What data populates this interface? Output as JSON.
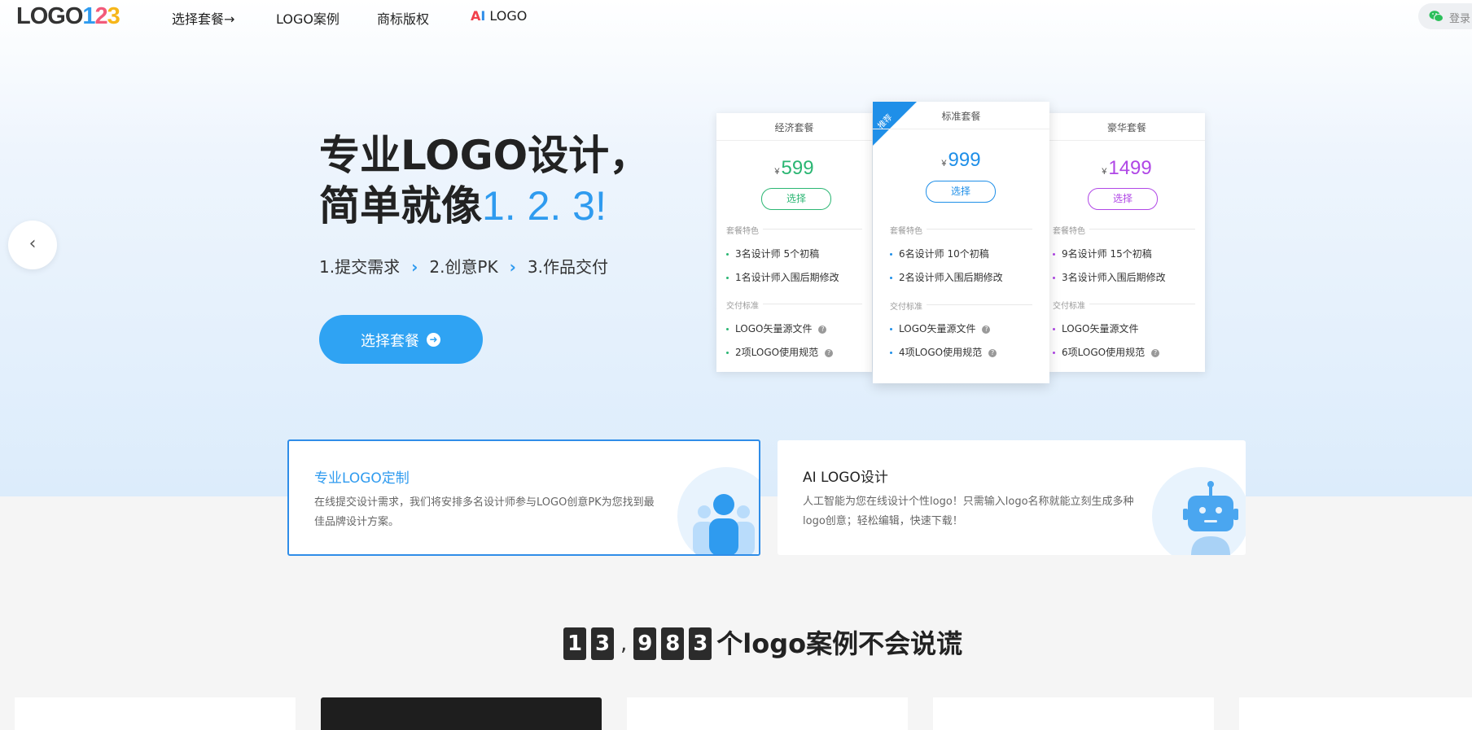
{
  "logo": {
    "prefix": "LOGO",
    "n1": "1",
    "n2": "2",
    "n3": "3"
  },
  "nav": {
    "items": [
      {
        "label": "选择套餐→"
      },
      {
        "label": "LOGO案例"
      },
      {
        "label": "商标版权"
      }
    ],
    "ai": {
      "a": "A",
      "i": "I",
      "rest": " LOGO"
    }
  },
  "login": {
    "label": "登录",
    "icon": "wechat-icon"
  },
  "carousel": {
    "prev_icon": "chevron-left-icon"
  },
  "hero": {
    "line1": "专业LOGO设计，",
    "line2_prefix": "简单就像",
    "line2_highlight": "1. 2. 3!",
    "steps": [
      "1.提交需求",
      "2.创意PK",
      "3.作品交付"
    ],
    "cta_label": "选择套餐",
    "cta_icon": "arrow-right-circle-icon"
  },
  "pricing": [
    {
      "title": "经济套餐",
      "currency": "¥",
      "price": "599",
      "color": "#2bb673",
      "select": "选择",
      "features_label": "套餐特色",
      "features": [
        "3名设计师 5个初稿",
        "1名设计师入围后期修改"
      ],
      "delivery_label": "交付标准",
      "delivery": [
        "LOGO矢量源文件",
        "2项LOGO使用规范"
      ]
    },
    {
      "title": "标准套餐",
      "currency": "¥",
      "price": "999",
      "color": "#1f8fe8",
      "select": "选择",
      "badge": "推荐",
      "features_label": "套餐特色",
      "features": [
        "6名设计师 10个初稿",
        "2名设计师入围后期修改"
      ],
      "delivery_label": "交付标准",
      "delivery": [
        "LOGO矢量源文件",
        "4项LOGO使用规范"
      ]
    },
    {
      "title": "豪华套餐",
      "currency": "¥",
      "price": "1499",
      "color": "#b047e6",
      "select": "选择",
      "features_label": "套餐特色",
      "features": [
        "9名设计师 15个初稿",
        "3名设计师入围后期修改"
      ],
      "delivery_label": "交付标准",
      "delivery": [
        "LOGO矢量源文件",
        "6项LOGO使用规范"
      ]
    }
  ],
  "services": [
    {
      "title": "专业LOGO定制",
      "desc": "在线提交设计需求，我们将安排多名设计师参与LOGO创意PK为您找到最佳品牌设计方案。",
      "icon": "users-icon",
      "active": true
    },
    {
      "title": "AI LOGO设计",
      "desc": "人工智能为您在线设计个性logo！只需输入logo名称就能立刻生成多种logo创意；轻松编辑，快速下载！",
      "icon": "robot-icon",
      "active": false
    }
  ],
  "counter": {
    "digits_a": [
      "1",
      "3"
    ],
    "sep": ",",
    "digits_b": [
      "9",
      "8",
      "3"
    ],
    "text": "个logo案例不会说谎"
  },
  "colors": {
    "accent": "#2fa3f3",
    "brand_blue": "#2f9bef"
  }
}
